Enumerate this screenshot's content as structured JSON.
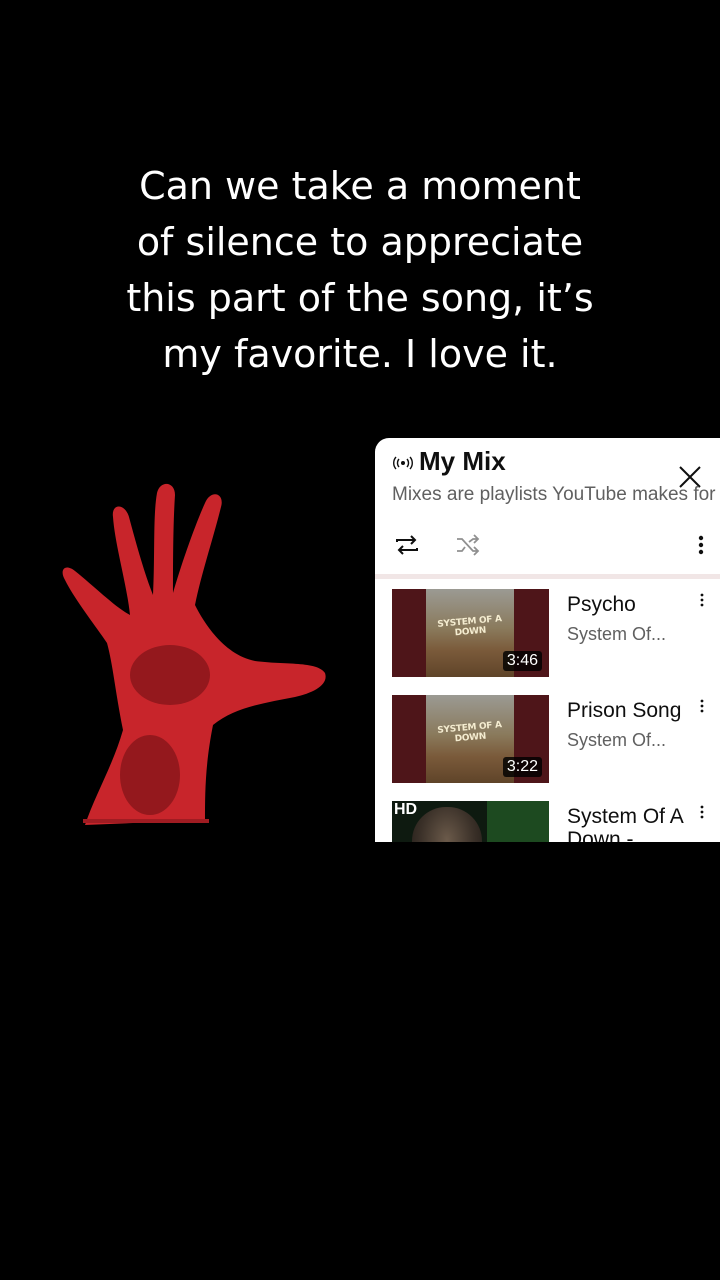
{
  "caption": {
    "line1": "Can we take a moment",
    "line2": "of silence to appreciate",
    "line3": "this part of the song, it’s",
    "line4": "my favorite. I love it."
  },
  "mix": {
    "title": "My Mix",
    "subtitle": "Mixes are playlists YouTube makes for you",
    "icons": [
      "live-broadcast-icon",
      "close-icon",
      "repeat-icon",
      "shuffle-icon",
      "more-vert-icon"
    ]
  },
  "playlist": [
    {
      "title": "Psycho",
      "artist": "System Of...",
      "duration": "3:46",
      "thumb_text": "SYSTEM OF A DOWN"
    },
    {
      "title": "Prison Song",
      "artist": "System Of...",
      "duration": "3:22",
      "thumb_text": "SYSTEM OF A DOWN"
    },
    {
      "title": "System Of A",
      "artist": "Down -",
      "badge": "HD"
    }
  ],
  "colors": {
    "accent_red": "#c8252b",
    "thumb_frame": "#4e1519",
    "divider": "#f1e6e6"
  }
}
